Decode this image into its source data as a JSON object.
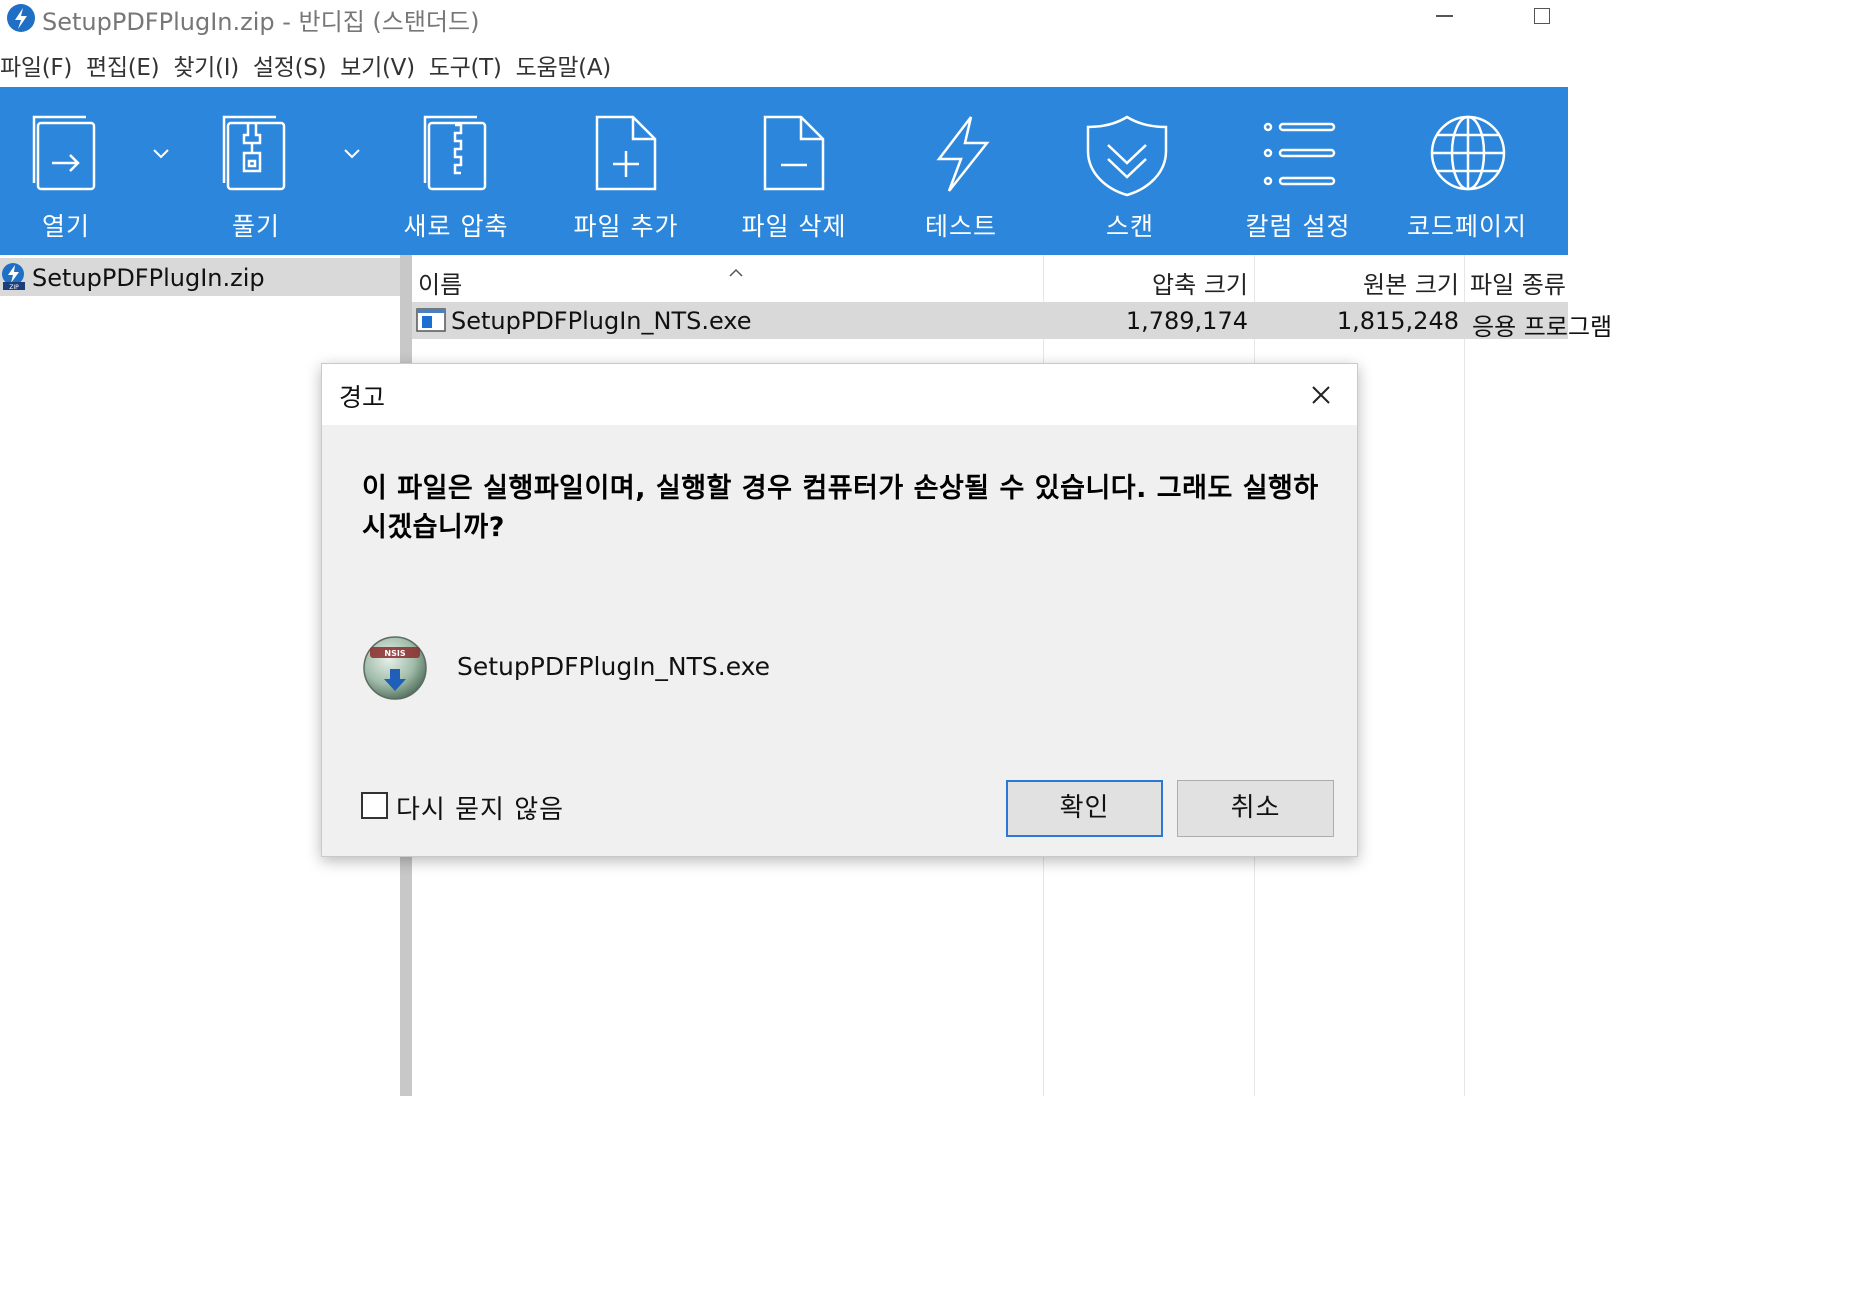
{
  "window": {
    "title": "SetupPDFPlugIn.zip - 반디집 (스탠더드)"
  },
  "menu": [
    {
      "label": "파일(F)"
    },
    {
      "label": "편집(E)"
    },
    {
      "label": "찾기(I)"
    },
    {
      "label": "설정(S)"
    },
    {
      "label": "보기(V)"
    },
    {
      "label": "도구(T)"
    },
    {
      "label": "도움말(A)"
    }
  ],
  "toolbar": {
    "open": "열기",
    "extract": "풀기",
    "new_archive": "새로 압축",
    "add_files": "파일 추가",
    "delete_files": "파일 삭제",
    "test": "테스트",
    "scan": "스캔",
    "column_settings": "칼럼 설정",
    "codepage": "코드페이지"
  },
  "tree": {
    "item": "SetupPDFPlugIn.zip"
  },
  "filelist": {
    "columns": {
      "name": "이름",
      "compressed_size": "압축 크기",
      "original_size": "원본 크기",
      "file_type": "파일 종류"
    },
    "rows": [
      {
        "name": "SetupPDFPlugIn_NTS.exe",
        "compressed_size": "1,789,174",
        "original_size": "1,815,248",
        "file_type": "응용 프로그램"
      }
    ]
  },
  "dialog": {
    "title": "경고",
    "message": "이 파일은 실행파일이며, 실행할 경우 컴퓨터가 손상될 수 있습니다. 그래도 실행하시겠습니까?",
    "filename": "SetupPDFPlugIn_NTS.exe",
    "icon_text": "NSIS",
    "checkbox_label": "다시 묻지 않음",
    "checkbox_checked": false,
    "ok_label": "확인",
    "cancel_label": "취소"
  },
  "colors": {
    "toolbar_bg": "#2c86dc",
    "selection_bg": "#d9d9d9",
    "dialog_bg": "#f0f0f0",
    "focus_border": "#2c78d4"
  }
}
